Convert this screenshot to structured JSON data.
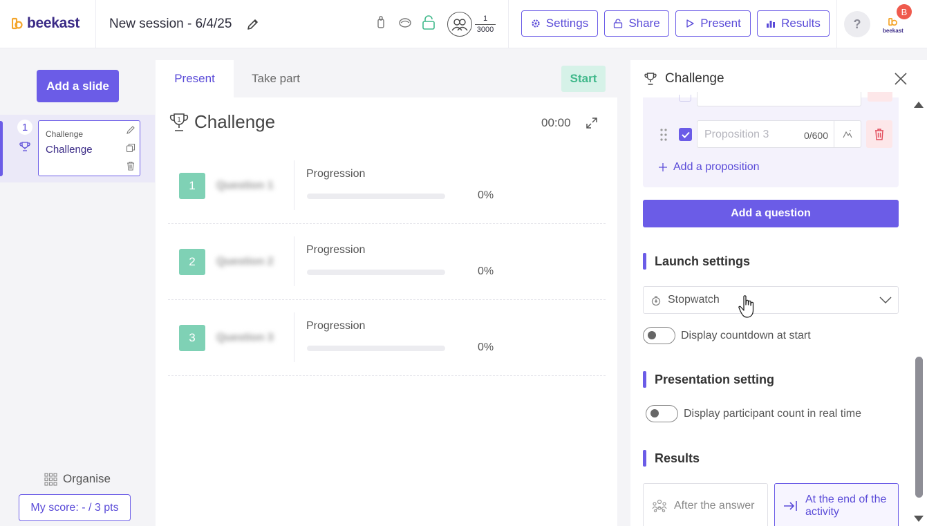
{
  "header": {
    "logo_text": "beekast",
    "session_title": "New session - 6/4/25",
    "participants_current": "1",
    "participants_max": "3000",
    "buttons": {
      "settings": "Settings",
      "share": "Share",
      "present": "Present",
      "results": "Results"
    },
    "help_label": "?",
    "avatar_initial": "B",
    "avatar_logo_text": "beekast"
  },
  "sidebar": {
    "add_slide_label": "Add a slide",
    "slides": [
      {
        "number": "1",
        "type_label": "Challenge",
        "title": "Challenge"
      }
    ],
    "organise_label": "Organise",
    "my_score_label": "My score: - / 3 pts"
  },
  "center": {
    "tabs": {
      "present": "Present",
      "take_part": "Take part"
    },
    "start_label": "Start",
    "challenge_title": "Challenge",
    "challenge_badge": "1",
    "timer": "00:00",
    "questions": [
      {
        "number": "1",
        "label": "Question 1",
        "progress_label": "Progression",
        "progress": 0,
        "progress_text": "0%"
      },
      {
        "number": "2",
        "label": "Question 2",
        "progress_label": "Progression",
        "progress": 0,
        "progress_text": "0%"
      },
      {
        "number": "3",
        "label": "Question 3",
        "progress_label": "Progression",
        "progress": 0,
        "progress_text": "0%"
      }
    ]
  },
  "right_panel": {
    "title": "Challenge",
    "proposition": {
      "placeholder": "Proposition 3",
      "counter": "0/600",
      "checked": true
    },
    "add_proposition_label": "Add a proposition",
    "add_question_label": "Add a question",
    "launch_settings": {
      "title": "Launch settings",
      "mode_value": "Stopwatch",
      "countdown_label": "Display countdown at start",
      "countdown_on": false
    },
    "presentation_setting": {
      "title": "Presentation setting",
      "participant_count_label": "Display participant count in real time",
      "participant_count_on": false
    },
    "results": {
      "title": "Results",
      "options": [
        {
          "label": "After the answer",
          "selected": false
        },
        {
          "label": "At the end of the activity",
          "selected": true
        }
      ]
    }
  },
  "colors": {
    "accent": "#6b5ce7",
    "question_number_bg": "#7fd1b5",
    "start_bg": "#d6f2e8",
    "danger_bg": "#fde7e9",
    "danger_icon": "#e24a5a",
    "avatar_badge": "#ef5a4d"
  },
  "icons": {
    "edit": "pencil-icon",
    "lock": "lock-icon",
    "participants": "people-icon",
    "settings": "gear-icon",
    "present": "play-icon",
    "results": "bar-chart-icon",
    "trophy": "trophy-icon",
    "copy": "copy-icon",
    "delete": "trash-icon",
    "organise": "grid-icon",
    "expand": "expand-icon",
    "close": "close-icon",
    "drag": "drag-handle-icon",
    "image": "image-icon",
    "stopwatch": "stopwatch-icon",
    "chevron": "chevron-down-icon",
    "group": "group-icon",
    "arrow_end": "arrow-to-end-icon"
  }
}
